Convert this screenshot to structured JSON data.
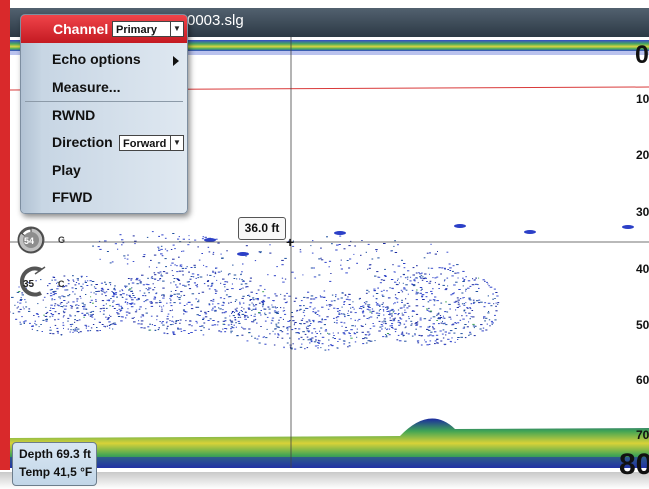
{
  "window": {
    "file_title": "0003.slg"
  },
  "menu": {
    "channel_label": "Channel",
    "channel_value": "Primary",
    "items": [
      "Echo options",
      "Measure...",
      "RWND"
    ],
    "direction_label": "Direction",
    "direction_value": "Forward",
    "play_label": "Play",
    "ffwd_label": "FFWD"
  },
  "depth_scale": {
    "top": "0",
    "ticks": [
      "10",
      "20",
      "30",
      "40",
      "50",
      "60",
      "70"
    ],
    "bottom": "80"
  },
  "cursor": {
    "depth_readout": "36.0 ft"
  },
  "gauges": {
    "gain_value": "54",
    "gain_letter": "G",
    "color_value": "35",
    "color_letter": "C"
  },
  "info": {
    "depth": "Depth 69.3  ft",
    "temp": "Temp  41,5 °F"
  },
  "colors": {
    "accent_red": "#d9292b",
    "sonar_blue": "#1b2aa0",
    "bottom_green": "#3fa455",
    "bottom_yellow": "#d8d238"
  }
}
